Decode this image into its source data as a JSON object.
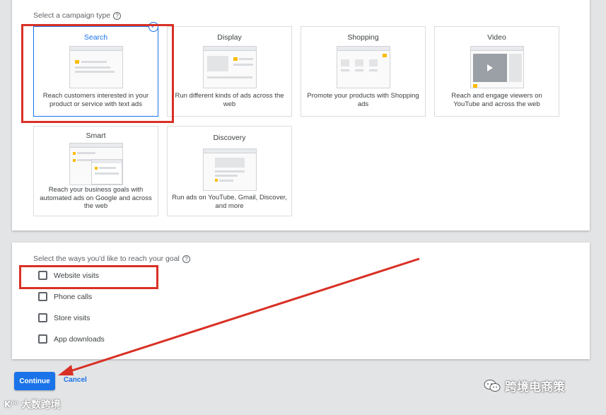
{
  "campaign_type": {
    "label": "Select a campaign type",
    "help_icon": "?",
    "cards": [
      {
        "title": "Search",
        "description": "Reach customers interested in your product or service with text ads",
        "selected": true
      },
      {
        "title": "Display",
        "description": "Run different kinds of ads across the web",
        "selected": false
      },
      {
        "title": "Shopping",
        "description": "Promote your products with Shopping ads",
        "selected": false
      },
      {
        "title": "Video",
        "description": "Reach and engage viewers on YouTube and across the web",
        "selected": false
      },
      {
        "title": "Smart",
        "description": "Reach your business goals with automated ads on Google and across the web",
        "selected": false
      },
      {
        "title": "Discovery",
        "description": "Run ads on YouTube, Gmail, Discover, and more",
        "selected": false
      }
    ]
  },
  "goal": {
    "label": "Select the ways you'd like to reach your goal",
    "help_icon": "?",
    "options": [
      {
        "label": "Website visits",
        "checked": false
      },
      {
        "label": "Phone calls",
        "checked": false
      },
      {
        "label": "Store visits",
        "checked": false
      },
      {
        "label": "App downloads",
        "checked": false
      }
    ]
  },
  "actions": {
    "continue_label": "Continue",
    "cancel_label": "Cancel"
  },
  "watermarks": {
    "right_text": "跨境电商策",
    "left_logo": "K⁰⁰",
    "left_text": "大数跨境"
  },
  "colors": {
    "accent": "#1a73e8",
    "annotation_red": "#d93025",
    "thumbnail_yellow": "#fbbc04",
    "background": "#e3e4e6"
  },
  "icons": {
    "selected_badge": "check-circle-icon",
    "help": "help-circle-icon",
    "play": "play-icon",
    "wechat": "wechat-icon"
  }
}
